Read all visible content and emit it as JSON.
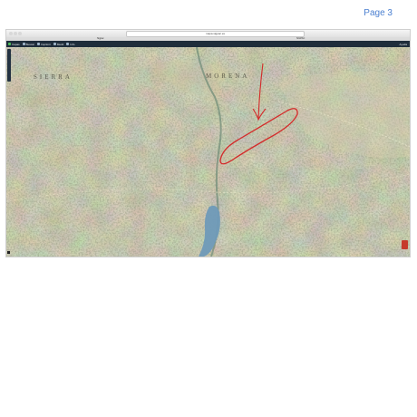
{
  "page": {
    "label": "Page 3"
  },
  "browser": {
    "address_text": "mapa.sigpac.es",
    "tabs": [
      "Sigpac",
      "SIGPAC"
    ]
  },
  "toolbar": {
    "items": [
      {
        "icon": "layers-icon",
        "label": "Capas"
      },
      {
        "icon": "search-icon",
        "label": "Buscar"
      },
      {
        "icon": "print-icon",
        "label": "Imprimir"
      },
      {
        "icon": "measure-icon",
        "label": "Medir"
      },
      {
        "icon": "info-icon",
        "label": "Info"
      }
    ],
    "right_label": "Ayuda"
  },
  "map": {
    "labels": [
      "SIERRA",
      "MORENA"
    ],
    "annotation_color": "#d42a2a",
    "reservoir_color": "#6f9ab8"
  }
}
